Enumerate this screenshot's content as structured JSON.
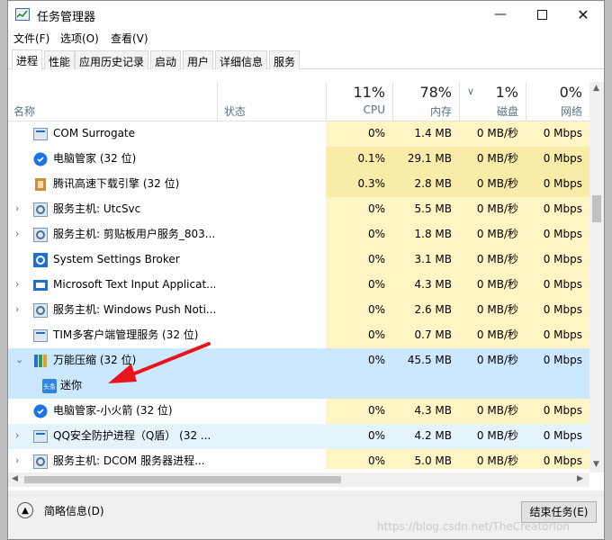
{
  "window": {
    "title": "任务管理器"
  },
  "menu": [
    "文件(F)",
    "选项(O)",
    "查看(V)"
  ],
  "tabs": [
    "进程",
    "性能",
    "应用历史记录",
    "启动",
    "用户",
    "详细信息",
    "服务"
  ],
  "header": {
    "name": "名称",
    "status": "状态",
    "cpu": {
      "pct": "11%",
      "label": "CPU"
    },
    "mem": {
      "pct": "78%",
      "label": "内存"
    },
    "disk": {
      "pct": "1%",
      "label": "磁盘"
    },
    "net": {
      "pct": "0%",
      "label": "网络"
    }
  },
  "rows": [
    {
      "name": "COM Surrogate",
      "cpu": "0%",
      "mem": "1.4 MB",
      "disk": "0 MB/秒",
      "net": "0 Mbps",
      "icon": "app-icon",
      "expand": "",
      "kind": "normal"
    },
    {
      "name": "电脑管家 (32 位)",
      "cpu": "0.1%",
      "mem": "29.1 MB",
      "disk": "0 MB/秒",
      "net": "0 Mbps",
      "icon": "shield-icon",
      "expand": "",
      "kind": "normal"
    },
    {
      "name": "腾讯高速下载引擎 (32 位)",
      "cpu": "0.3%",
      "mem": "2.8 MB",
      "disk": "0 MB/秒",
      "net": "0 Mbps",
      "icon": "download-icon",
      "expand": "",
      "kind": "normal"
    },
    {
      "name": "服务主机: UtcSvc",
      "cpu": "0%",
      "mem": "5.5 MB",
      "disk": "0 MB/秒",
      "net": "0 Mbps",
      "icon": "gear-icon",
      "expand": "›",
      "kind": "normal"
    },
    {
      "name": "服务主机: 剪贴板用户服务_803...",
      "cpu": "0%",
      "mem": "1.8 MB",
      "disk": "0 MB/秒",
      "net": "0 Mbps",
      "icon": "gear-icon",
      "expand": "›",
      "kind": "normal"
    },
    {
      "name": "System Settings Broker",
      "cpu": "0%",
      "mem": "3.1 MB",
      "disk": "0 MB/秒",
      "net": "0 Mbps",
      "icon": "settings-icon",
      "expand": "",
      "kind": "normal"
    },
    {
      "name": "Microsoft Text Input Applicat...",
      "cpu": "0%",
      "mem": "4.3 MB",
      "disk": "0 MB/秒",
      "net": "0 Mbps",
      "icon": "keyboard-icon",
      "expand": "›",
      "kind": "normal"
    },
    {
      "name": "服务主机: Windows Push Noti...",
      "cpu": "0%",
      "mem": "2.6 MB",
      "disk": "0 MB/秒",
      "net": "0 Mbps",
      "icon": "gear-icon",
      "expand": "›",
      "kind": "normal"
    },
    {
      "name": "TIM多客户端管理服务 (32 位)",
      "cpu": "0%",
      "mem": "0.7 MB",
      "disk": "0 MB/秒",
      "net": "0 Mbps",
      "icon": "app-icon",
      "expand": "",
      "kind": "normal"
    },
    {
      "name": "万能压缩 (32 位)",
      "cpu": "0%",
      "mem": "45.5 MB",
      "disk": "0 MB/秒",
      "net": "0 Mbps",
      "icon": "archive-icon",
      "expand": "⌄",
      "kind": "sel"
    },
    {
      "name": "迷你",
      "cpu": "",
      "mem": "",
      "disk": "",
      "net": "",
      "icon": "mini-icon",
      "expand": "",
      "kind": "child"
    },
    {
      "name": "电脑管家-小火箭 (32 位)",
      "cpu": "0%",
      "mem": "4.3 MB",
      "disk": "0 MB/秒",
      "net": "0 Mbps",
      "icon": "shield-icon",
      "expand": "",
      "kind": "normal"
    },
    {
      "name": "QQ安全防护进程（Q盾）  (32 ...",
      "cpu": "0%",
      "mem": "4.2 MB",
      "disk": "0 MB/秒",
      "net": "0 Mbps",
      "icon": "app-icon",
      "expand": "›",
      "kind": "hl"
    },
    {
      "name": "服务主机: DCOM 服务器进程...",
      "cpu": "0%",
      "mem": "5.0 MB",
      "disk": "0 MB/秒",
      "net": "0 Mbps",
      "icon": "gear-icon",
      "expand": "›",
      "kind": "normal"
    }
  ],
  "footer": {
    "fewer_details": "简略信息(D)",
    "end_task": "结束任务(E)"
  },
  "watermark": "https://blog.csdn.net/TheCreatorIon"
}
